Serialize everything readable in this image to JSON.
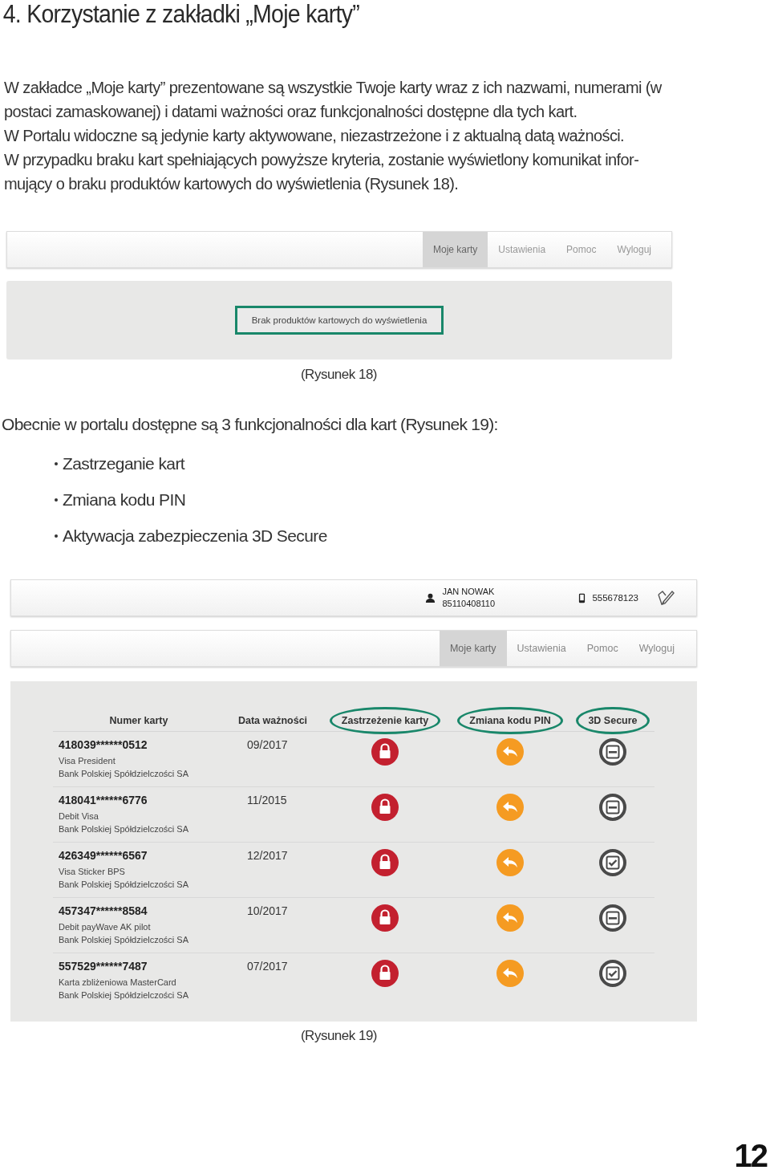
{
  "heading": "4. Korzystanie z zakładki „Moje karty”",
  "paragraphs": [
    "W zakładce „Moje karty” prezentowane są wszystkie Twoje karty wraz z ich nazwami, numerami (w postaci zamaskowanej) i datami ważności oraz funkcjonalności dostępne dla tych kart.",
    "W Portalu widoczne są jedynie karty aktywowane, niezastrzeżone i z aktualną datą ważności.",
    "W przypadku braku kart spełniających powyższe kryteria, zostanie wyświetlony komunikat infor-mujący o braku produktów kartowych do wyświetlenia (Rysunek 18)."
  ],
  "figure_18": {
    "tabs": [
      {
        "label": "Moje karty",
        "selected": true
      },
      {
        "label": "Ustawienia",
        "selected": false
      },
      {
        "label": "Pomoc",
        "selected": false
      },
      {
        "label": "Wyloguj",
        "selected": false
      }
    ],
    "message": "Brak produktów kartowych do wyświetlenia",
    "caption": "(Rysunek 18)"
  },
  "intro": "Obecnie w portalu dostępne są 3 funkcjonalności dla kart (Rysunek 19):",
  "bullets": [
    "Zastrzeganie kart",
    "Zmiana kodu PIN",
    "Aktywacja zabezpieczenia 3D Secure"
  ],
  "figure_19": {
    "user": {
      "name": "JAN NOWAK",
      "id": "85110408110",
      "phone": "555678123"
    },
    "tabs": [
      {
        "label": "Moje karty",
        "selected": true
      },
      {
        "label": "Ustawienia",
        "selected": false
      },
      {
        "label": "Pomoc",
        "selected": false
      },
      {
        "label": "Wyloguj",
        "selected": false
      }
    ],
    "columns": [
      "Numer karty",
      "Data ważności",
      "Zastrzeżenie karty",
      "Zmiana kodu PIN",
      "3D Secure"
    ],
    "rows": [
      {
        "number": "418039******0512",
        "name": "Visa President",
        "bank": "Bank Polskiej Spółdzielczości SA",
        "expiry": "09/2017",
        "secure_3d": false
      },
      {
        "number": "418041******6776",
        "name": "Debit Visa",
        "bank": "Bank Polskiej Spółdzielczości SA",
        "expiry": "11/2015",
        "secure_3d": false
      },
      {
        "number": "426349******6567",
        "name": "Visa Sticker BPS",
        "bank": "Bank Polskiej Spółdzielczości SA",
        "expiry": "12/2017",
        "secure_3d": true
      },
      {
        "number": "457347******8584",
        "name": "Debit payWave AK pilot",
        "bank": "Bank Polskiej Spółdzielczości SA",
        "expiry": "10/2017",
        "secure_3d": false
      },
      {
        "number": "557529******7487",
        "name": "Karta zbliżeniowa MasterCard",
        "bank": "Bank Polskiej Spółdzielczości SA",
        "expiry": "07/2017",
        "secure_3d": true
      }
    ],
    "caption": "(Rysunek 19)"
  },
  "page_number": "12"
}
